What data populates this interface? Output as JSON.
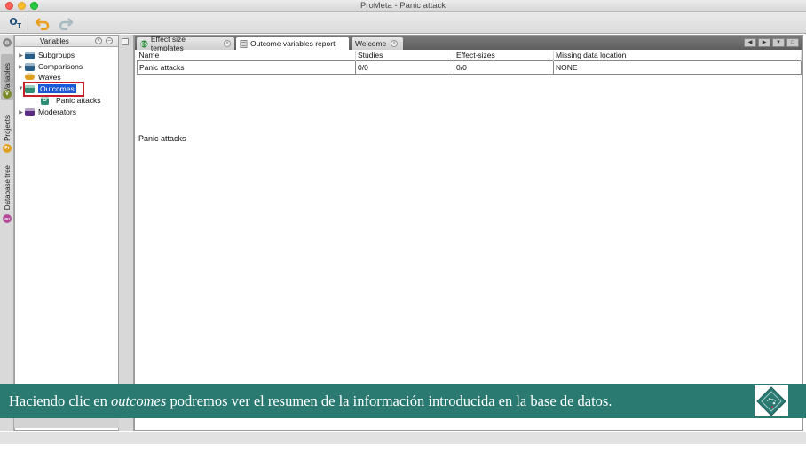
{
  "window": {
    "title": "ProMeta - Panic attack"
  },
  "toolbar": {
    "icons": [
      "ot-icon",
      "undo-icon",
      "redo-icon"
    ]
  },
  "side_strip": {
    "tabs": [
      {
        "label": "Variables",
        "icon": "V"
      },
      {
        "label": "Projects",
        "icon": "Pr"
      },
      {
        "label": "Database tree",
        "icon": "DbT"
      }
    ]
  },
  "variables_panel": {
    "title": "Variables",
    "items": [
      {
        "label": "Subgroups",
        "color": "#2a5d86"
      },
      {
        "label": "Comparisons",
        "color": "#2a5d86"
      },
      {
        "label": "Waves",
        "color": "#e0a020"
      },
      {
        "label": "Outcomes",
        "color": "#2e8c74",
        "selected": true
      },
      {
        "label": "Panic attacks",
        "color": "#2e8c74",
        "badge": "O"
      },
      {
        "label": "Moderators",
        "color": "#5a2d82"
      }
    ]
  },
  "tabs": [
    {
      "label": "Effect size templates",
      "active": false
    },
    {
      "label": "Outcome variables report",
      "active": true
    },
    {
      "label": "Welcome",
      "active": false
    }
  ],
  "report": {
    "columns": [
      "Name",
      "Studies",
      "Effect-sizes",
      "Missing data location"
    ],
    "rows": [
      [
        "Panic attacks",
        "0/0",
        "0/0",
        "NONE"
      ]
    ],
    "section_title": "Panic attacks"
  },
  "caption": {
    "before": "Haciendo clic en ",
    "emphasis": "outcomes",
    "after": " podremos ver el resumen de la información introducida en la base de datos."
  },
  "colors": {
    "caption_bg": "#2a7a72",
    "selection": "#1a5ad8",
    "highlight": "#c81e2a"
  }
}
